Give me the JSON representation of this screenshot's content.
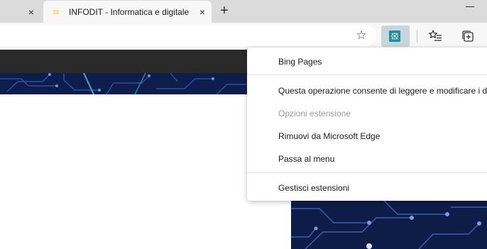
{
  "browser": {
    "active_tab_title": "INFODIT - Informatica e digitale",
    "tab_close_glyph": "×",
    "new_tab_glyph": "+"
  },
  "toolbar": {
    "icons": [
      "star-icon",
      "extension-icon",
      "favorites-icon",
      "collections-icon"
    ],
    "extension_color": "#1e8f9f"
  },
  "context_menu": {
    "extension_name": "Bing Pages",
    "items": [
      {
        "label": "Questa operazione consente di leggere e modificare i d",
        "enabled": true
      },
      {
        "label": "Opzioni estensione",
        "enabled": false
      },
      {
        "label": "Rimuovi da Microsoft Edge",
        "enabled": true
      },
      {
        "label": "Passa al menu",
        "enabled": true
      }
    ],
    "manage_label": "Gestisci estensioni"
  }
}
